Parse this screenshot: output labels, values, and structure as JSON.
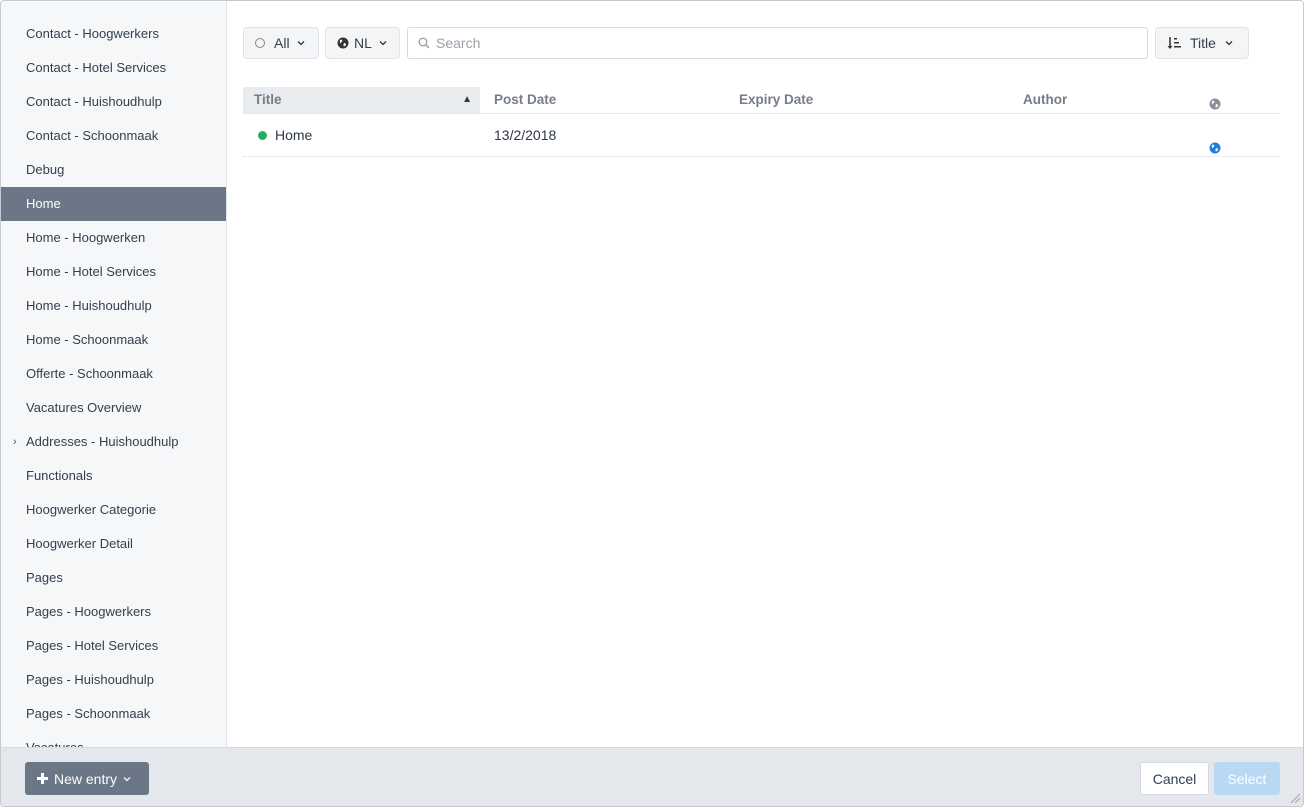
{
  "sidebar": {
    "items": [
      {
        "label": "Contact - Hoogwerkers"
      },
      {
        "label": "Contact - Hotel Services"
      },
      {
        "label": "Contact - Huishoudhulp"
      },
      {
        "label": "Contact - Schoonmaak"
      },
      {
        "label": "Debug"
      },
      {
        "label": "Home",
        "active": true
      },
      {
        "label": "Home - Hoogwerken"
      },
      {
        "label": "Home - Hotel Services"
      },
      {
        "label": "Home - Huishoudhulp"
      },
      {
        "label": "Home - Schoonmaak"
      },
      {
        "label": "Offerte - Schoonmaak"
      },
      {
        "label": "Vacatures Overview"
      },
      {
        "label": "Addresses - Huishoudhulp",
        "expandable": true
      },
      {
        "label": "Functionals"
      },
      {
        "label": "Hoogwerker Categorie"
      },
      {
        "label": "Hoogwerker Detail"
      },
      {
        "label": "Pages"
      },
      {
        "label": "Pages - Hoogwerkers"
      },
      {
        "label": "Pages - Hotel Services"
      },
      {
        "label": "Pages - Huishoudhulp"
      },
      {
        "label": "Pages - Schoonmaak"
      },
      {
        "label": "Vacatures"
      }
    ]
  },
  "toolbar": {
    "status_label": "All",
    "site_label": "NL",
    "search_placeholder": "Search",
    "search_value": "",
    "sort_label": "Title"
  },
  "table": {
    "columns": {
      "title": "Title",
      "post_date": "Post Date",
      "expiry_date": "Expiry Date",
      "author": "Author"
    },
    "sort_arrow": "▲",
    "rows": [
      {
        "title": "Home",
        "status": "live",
        "post_date": "13/2/2018",
        "expiry_date": "",
        "author": ""
      }
    ]
  },
  "footer": {
    "new_entry_label": "New entry",
    "cancel_label": "Cancel",
    "select_label": "Select"
  },
  "colors": {
    "active_item_bg": "#6b7686",
    "status_live": "#27ab5e",
    "select_disabled": "#b9d8f3",
    "globe_blue": "#1e7fe0"
  },
  "icons": {
    "status": "status-ring-icon",
    "site": "globe-icon",
    "search": "search-icon",
    "sort": "sort-icon",
    "plus": "plus-icon"
  }
}
